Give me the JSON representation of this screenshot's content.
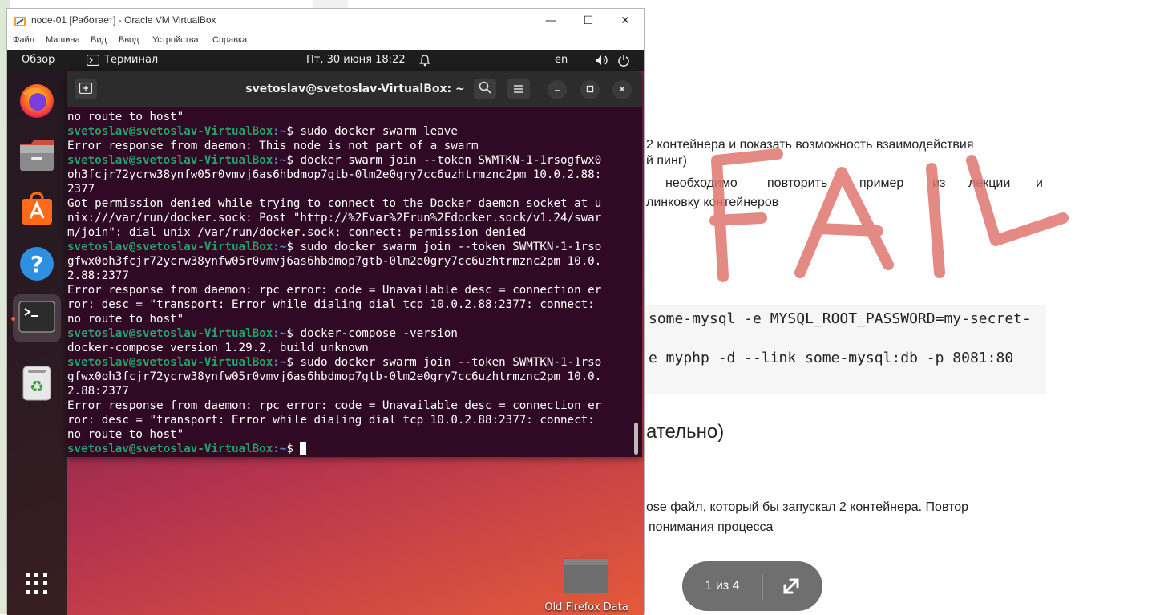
{
  "document": {
    "para1_line1": "2 контейнера и показать возможность взаимодействия",
    "para1_line2": "й пинг)",
    "para2_line1_a": "необходимо",
    "para2_line1_b": "повторить",
    "para2_line1_c": "пример",
    "para2_line1_d": "из",
    "para2_line1_e": "лекции",
    "para2_line1_f": "и",
    "para2_line2": "линковку контейнеров",
    "code_line1": "some-mysql -e MYSQL_ROOT_PASSWORD=my-secret-",
    "code_line2": "e myphp -d --link some-mysql:db -p 8081:80",
    "heading": "ательно)",
    "para3_line1": "ose файл, который бы запускал 2 контейнера. Повтор",
    "para3_line2": "понимания процесса",
    "annotation": "FAIL",
    "annotation_color": "#e0766f",
    "pager": {
      "label": "1 из 4",
      "expand_icon": "expand-icon"
    }
  },
  "vbox": {
    "title": "node-01 [Работает] - Oracle VM VirtualBox",
    "menu": [
      "Файл",
      "Машина",
      "Вид",
      "Ввод",
      "Устройства",
      "Справка"
    ],
    "controls": {
      "minimize": "—",
      "maximize": "☐",
      "close": "✕"
    }
  },
  "ubuntu": {
    "topbar": {
      "activities": "Обзор",
      "app_name": "Терминал",
      "datetime": "Пт, 30 июня  18:22",
      "language": "en"
    },
    "dock": [
      {
        "name": "firefox",
        "icon": "firefox-icon"
      },
      {
        "name": "files",
        "icon": "files-icon"
      },
      {
        "name": "app-center",
        "icon": "app-center-icon"
      },
      {
        "name": "help",
        "icon": "help-icon"
      },
      {
        "name": "terminal",
        "icon": "terminal-icon",
        "active": true
      },
      {
        "name": "trash",
        "icon": "trash-icon"
      },
      {
        "name": "show-apps",
        "icon": "apps-grid-icon"
      }
    ],
    "desktop_folder_label": "Old Firefox Data",
    "accent": "#e95420"
  },
  "terminal": {
    "title": "svetoslav@svetoslav-VirtualBox: ~",
    "prompt_user": "svetoslav@svetoslav-VirtualBox",
    "prompt_path": ":~",
    "prompt_sym": "$ ",
    "lines": [
      {
        "t": "out",
        "text": "no route to host\""
      },
      {
        "t": "cmd",
        "text": "sudo docker swarm leave"
      },
      {
        "t": "out",
        "text": "Error response from daemon: This node is not part of a swarm"
      },
      {
        "t": "cmd",
        "text": "docker swarm join --token SWMTKN-1-1rsogfwx0"
      },
      {
        "t": "out",
        "text": "oh3fcjr72ycrw38ynfw05r0vmvj6as6hbdmop7gtb-0lm2e0gry7cc6uzhtrmznc2pm 10.0.2.88:"
      },
      {
        "t": "out",
        "text": "2377"
      },
      {
        "t": "out",
        "text": "Got permission denied while trying to connect to the Docker daemon socket at u"
      },
      {
        "t": "out",
        "text": "nix:///var/run/docker.sock: Post \"http://%2Fvar%2Frun%2Fdocker.sock/v1.24/swar"
      },
      {
        "t": "out",
        "text": "m/join\": dial unix /var/run/docker.sock: connect: permission denied"
      },
      {
        "t": "cmd",
        "text": "sudo docker swarm join --token SWMTKN-1-1rso"
      },
      {
        "t": "out",
        "text": "gfwx0oh3fcjr72ycrw38ynfw05r0vmvj6as6hbdmop7gtb-0lm2e0gry7cc6uzhtrmznc2pm 10.0."
      },
      {
        "t": "out",
        "text": "2.88:2377"
      },
      {
        "t": "out",
        "text": "Error response from daemon: rpc error: code = Unavailable desc = connection er"
      },
      {
        "t": "out",
        "text": "ror: desc = \"transport: Error while dialing dial tcp 10.0.2.88:2377: connect:"
      },
      {
        "t": "out",
        "text": "no route to host\""
      },
      {
        "t": "cmd",
        "text": "docker-compose -version"
      },
      {
        "t": "out",
        "text": "docker-compose version 1.29.2, build unknown"
      },
      {
        "t": "cmd",
        "text": "sudo docker swarm join --token SWMTKN-1-1rso"
      },
      {
        "t": "out",
        "text": "gfwx0oh3fcjr72ycrw38ynfw05r0vmvj6as6hbdmop7gtb-0lm2e0gry7cc6uzhtrmznc2pm 10.0."
      },
      {
        "t": "out",
        "text": "2.88:2377"
      },
      {
        "t": "out",
        "text": "Error response from daemon: rpc error: code = Unavailable desc = connection er"
      },
      {
        "t": "out",
        "text": "ror: desc = \"transport: Error while dialing dial tcp 10.0.2.88:2377: connect:"
      },
      {
        "t": "out",
        "text": "no route to host\""
      },
      {
        "t": "prompt",
        "text": ""
      }
    ]
  }
}
